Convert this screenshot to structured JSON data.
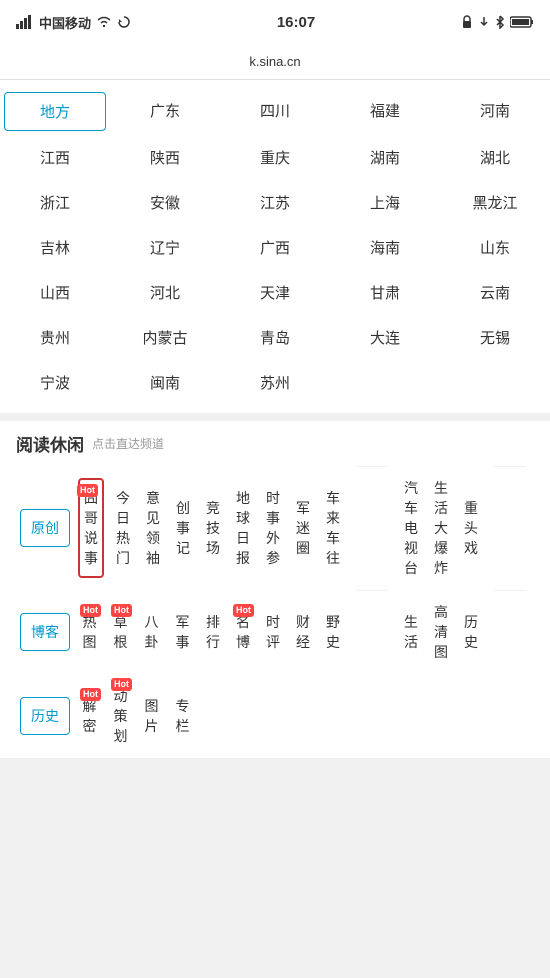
{
  "statusBar": {
    "carrier": "中国移动",
    "time": "16:07",
    "url": "k.sina.cn"
  },
  "regionGrid": {
    "items": [
      {
        "label": "地方",
        "highlight": true
      },
      {
        "label": "广东"
      },
      {
        "label": "四川"
      },
      {
        "label": "福建"
      },
      {
        "label": "河南"
      },
      {
        "label": "江西"
      },
      {
        "label": "陕西"
      },
      {
        "label": "重庆"
      },
      {
        "label": "湖南"
      },
      {
        "label": "湖北"
      },
      {
        "label": "浙江"
      },
      {
        "label": "安徽"
      },
      {
        "label": "江苏"
      },
      {
        "label": "上海"
      },
      {
        "label": "黑龙江"
      },
      {
        "label": "吉林"
      },
      {
        "label": "辽宁"
      },
      {
        "label": "广西"
      },
      {
        "label": "海南"
      },
      {
        "label": "山东"
      },
      {
        "label": "山西"
      },
      {
        "label": "河北"
      },
      {
        "label": "天津"
      },
      {
        "label": "甘肃"
      },
      {
        "label": "云南"
      },
      {
        "label": "贵州"
      },
      {
        "label": "内蒙古"
      },
      {
        "label": "青岛"
      },
      {
        "label": "大连"
      },
      {
        "label": "无锡"
      },
      {
        "label": "宁波"
      },
      {
        "label": "闽南"
      },
      {
        "label": "苏州"
      },
      {
        "label": ""
      },
      {
        "label": ""
      }
    ]
  },
  "readingSection": {
    "title": "阅读休闲",
    "subtitle": "点击直达频道",
    "channels": [
      {
        "label": "原创",
        "tabStyle": true,
        "blue": true,
        "hot": false,
        "highlighted": false
      },
      {
        "label": "囧哥说事",
        "tabStyle": false,
        "blue": false,
        "hot": true,
        "highlighted": true
      },
      {
        "label": "今日热门",
        "tabStyle": false,
        "blue": false,
        "hot": false,
        "highlighted": false
      },
      {
        "label": "意见领袖",
        "tabStyle": false,
        "blue": false,
        "hot": false,
        "highlighted": false
      },
      {
        "label": "创事记",
        "tabStyle": false,
        "blue": false,
        "hot": false,
        "highlighted": false
      },
      {
        "label": "竞技场",
        "tabStyle": false,
        "blue": false,
        "hot": false,
        "highlighted": false
      },
      {
        "label": "地球日报",
        "tabStyle": false,
        "blue": false,
        "hot": false,
        "highlighted": false
      },
      {
        "label": "时事外参",
        "tabStyle": false,
        "blue": false,
        "hot": false,
        "highlighted": false
      },
      {
        "label": "军迷圈",
        "tabStyle": false,
        "blue": false,
        "hot": false,
        "highlighted": false
      },
      {
        "label": "车来车往",
        "tabStyle": false,
        "blue": false,
        "hot": false,
        "highlighted": false
      },
      {
        "label": "汽车电视台",
        "tabStyle": false,
        "blue": false,
        "hot": false,
        "highlighted": false,
        "wide": true
      },
      {
        "label": "生活大爆炸",
        "tabStyle": false,
        "blue": false,
        "hot": false,
        "highlighted": false,
        "wide": true
      },
      {
        "label": "重头戏",
        "tabStyle": false,
        "blue": false,
        "hot": false,
        "highlighted": false
      },
      {
        "label": "",
        "tabStyle": false,
        "hot": false
      },
      {
        "label": "",
        "tabStyle": false,
        "hot": false
      },
      {
        "label": "博客",
        "tabStyle": true,
        "blue": true,
        "hot": false,
        "highlighted": false
      },
      {
        "label": "热图",
        "tabStyle": false,
        "blue": false,
        "hot": true,
        "highlighted": false
      },
      {
        "label": "草根",
        "tabStyle": false,
        "blue": false,
        "hot": true,
        "highlighted": false
      },
      {
        "label": "八卦",
        "tabStyle": false,
        "blue": false,
        "hot": false,
        "highlighted": false
      },
      {
        "label": "军事",
        "tabStyle": false,
        "blue": false,
        "hot": false,
        "highlighted": false
      },
      {
        "label": "排行",
        "tabStyle": false,
        "blue": false,
        "hot": false,
        "highlighted": false
      },
      {
        "label": "名博",
        "tabStyle": false,
        "blue": false,
        "hot": true,
        "highlighted": false
      },
      {
        "label": "时评",
        "tabStyle": false,
        "blue": false,
        "hot": false,
        "highlighted": false
      },
      {
        "label": "财经",
        "tabStyle": false,
        "blue": false,
        "hot": false,
        "highlighted": false
      },
      {
        "label": "野史",
        "tabStyle": false,
        "blue": false,
        "hot": false,
        "highlighted": false
      },
      {
        "label": "生活",
        "tabStyle": false,
        "blue": false,
        "hot": false,
        "highlighted": false
      },
      {
        "label": "高清图",
        "tabStyle": false,
        "blue": false,
        "hot": false,
        "highlighted": false
      },
      {
        "label": "历史",
        "tabStyle": false,
        "blue": false,
        "hot": false,
        "highlighted": false
      },
      {
        "label": "",
        "tabStyle": false,
        "hot": false
      },
      {
        "label": "",
        "tabStyle": false,
        "hot": false
      },
      {
        "label": "历史",
        "tabStyle": true,
        "blue": true,
        "hot": false,
        "highlighted": false
      },
      {
        "label": "解密",
        "tabStyle": false,
        "blue": false,
        "hot": true,
        "highlighted": false
      },
      {
        "label": "动策划",
        "tabStyle": false,
        "blue": false,
        "hot": true,
        "highlighted": false
      },
      {
        "label": "图片",
        "tabStyle": false,
        "blue": false,
        "hot": false,
        "highlighted": false
      },
      {
        "label": "专栏",
        "tabStyle": false,
        "blue": false,
        "hot": false,
        "highlighted": false
      }
    ]
  }
}
